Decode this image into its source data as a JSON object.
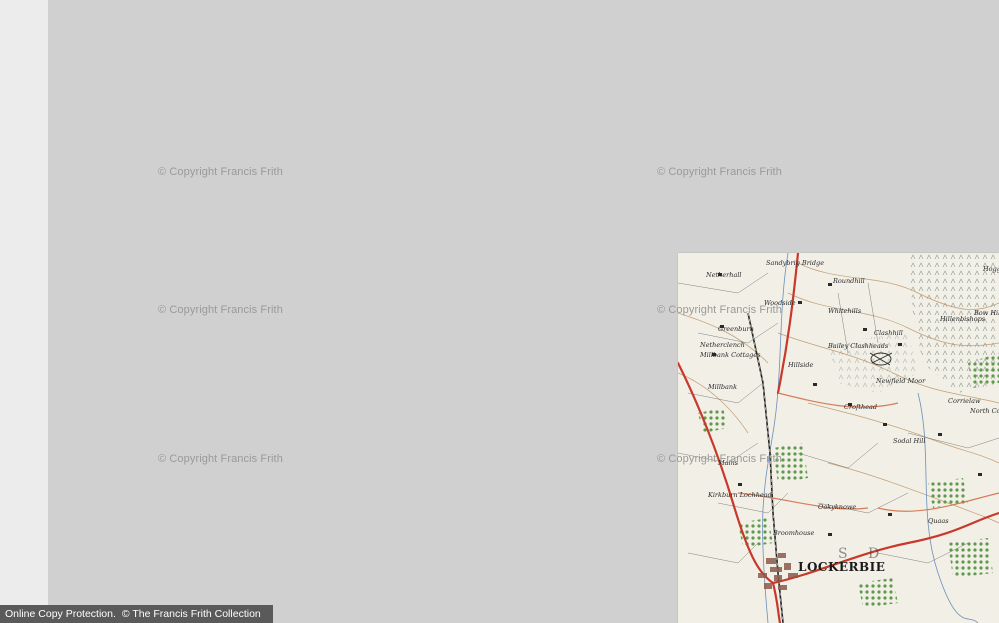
{
  "watermark": {
    "text": "© Copyright Francis Frith"
  },
  "footer": {
    "protection": "Online Copy Protection.",
    "copyright": "© The Francis Frith Collection"
  },
  "map": {
    "town_label": "LOCKERBIE",
    "place_labels": [
      "Netherhall",
      "Greenburn",
      "Netherclench",
      "Millbank Cottages",
      "Millbank",
      "Hillside",
      "Woodside",
      "Sandybrig Bridge",
      "Newfield Moor",
      "Crofthead",
      "Bailey Clashheads",
      "Clashhill",
      "Whitehills",
      "Roundhill",
      "Sodal Hill",
      "Broomhouse",
      "Mains",
      "Kirkburn Lochhead",
      "Oakyknowe",
      "Corrielaw",
      "Hillenbishops",
      "Bow Hill",
      "North Corrielaw",
      "Quaas",
      "Hogg"
    ],
    "colors": {
      "paper": "#f1efe6",
      "road": "#c8382b",
      "woodland": "#6da85a",
      "contour": "#b88a5a",
      "ink": "#2a2a2a",
      "moor": "#9fb0a8"
    }
  }
}
